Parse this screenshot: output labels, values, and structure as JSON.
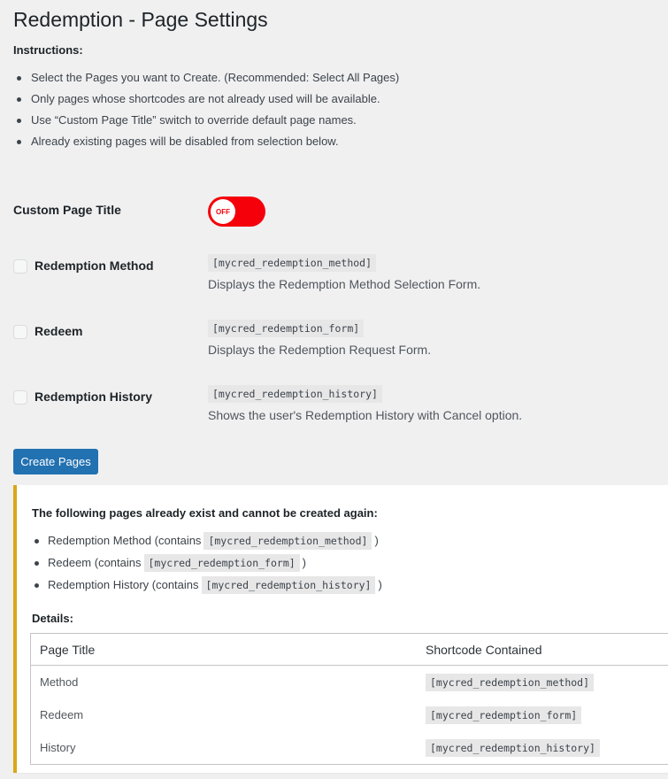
{
  "page": {
    "title": "Redemption - Page Settings"
  },
  "instructions": {
    "label": "Instructions:",
    "items": [
      "Select the Pages you want to Create. (Recommended: Select All Pages)",
      "Only pages whose shortcodes are not already used will be available.",
      "Use “Custom Page Title” switch to override default page names.",
      "Already existing pages will be disabled from selection below."
    ]
  },
  "custom_title": {
    "label": "Custom Page Title",
    "toggle_text": "OFF",
    "toggle_state": "off",
    "toggle_color": "#f5000a"
  },
  "pages": [
    {
      "name": "Redemption Method",
      "shortcode": "[mycred_redemption_method]",
      "description": "Displays the Redemption Method Selection Form.",
      "checked": false,
      "disabled": true
    },
    {
      "name": "Redeem",
      "shortcode": "[mycred_redemption_form]",
      "description": "Displays the Redemption Request Form.",
      "checked": false,
      "disabled": true
    },
    {
      "name": "Redemption History",
      "shortcode": "[mycred_redemption_history]",
      "description": "Shows the user's Redemption History with Cancel option.",
      "checked": false,
      "disabled": true
    }
  ],
  "create_button": {
    "label": "Create Pages",
    "color": "#2271b1"
  },
  "notice": {
    "title": "The following pages already exist and cannot be created again:",
    "accent_color": "#dba617",
    "items": [
      {
        "prefix": "Redemption Method (contains",
        "code": "[mycred_redemption_method]",
        "suffix": ")"
      },
      {
        "prefix": "Redeem (contains",
        "code": "[mycred_redemption_form]",
        "suffix": ")"
      },
      {
        "prefix": "Redemption History (contains",
        "code": "[mycred_redemption_history]",
        "suffix": ")"
      }
    ],
    "details_label": "Details:",
    "table": {
      "headers": [
        "Page Title",
        "Shortcode Contained"
      ],
      "rows": [
        [
          "Method",
          "[mycred_redemption_method]"
        ],
        [
          "Redeem",
          "[mycred_redemption_form]"
        ],
        [
          "History",
          "[mycred_redemption_history]"
        ]
      ]
    }
  }
}
